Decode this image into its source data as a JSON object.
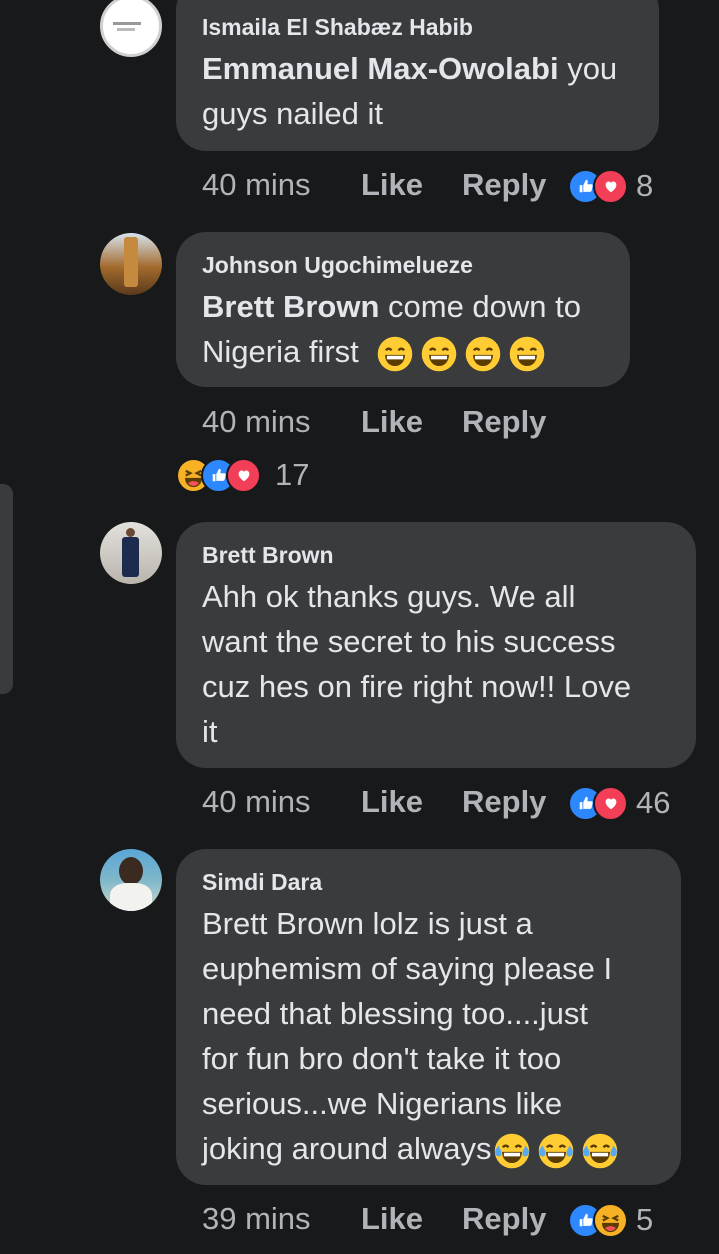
{
  "comments": [
    {
      "author": "Ismaila El Shabæz Habib",
      "mention": "Emmanuel Max-Owolabi",
      "text_lines": [
        " you",
        "guys nailed it"
      ],
      "time": "40 mins",
      "like_label": "Like",
      "reply_label": "Reply",
      "reactions": [
        "like",
        "love"
      ],
      "reaction_count": "8"
    },
    {
      "author": "Johnson Ugochimelueze",
      "mention": "Brett Brown",
      "text_lines": [
        " come down to",
        "Nigeria first"
      ],
      "emojis": [
        "grinning-squint-emoji",
        "grinning-squint-emoji",
        "grinning-squint-emoji",
        "grinning-squint-emoji"
      ],
      "time": "40 mins",
      "like_label": "Like",
      "reply_label": "Reply",
      "reactions": [
        "haha",
        "like",
        "love"
      ],
      "reaction_count": "17"
    },
    {
      "author": "Brett Brown",
      "text_lines": [
        "Ahh ok thanks guys. We all",
        "want the secret to his success",
        "cuz hes on fire right now!! Love",
        "it"
      ],
      "time": "40 mins",
      "like_label": "Like",
      "reply_label": "Reply",
      "reactions": [
        "like",
        "love"
      ],
      "reaction_count": "46"
    },
    {
      "author": "Simdi Dara",
      "text_lines": [
        "Brett Brown lolz is just a",
        "euphemism of saying please I",
        "need that blessing too....just",
        "for fun bro don't take it too",
        "serious...we Nigerians like",
        "joking around always"
      ],
      "emojis": [
        "tears-of-joy-emoji",
        "tears-of-joy-emoji",
        "tears-of-joy-emoji"
      ],
      "time": "39 mins",
      "like_label": "Like",
      "reply_label": "Reply",
      "reactions": [
        "like",
        "haha"
      ],
      "reaction_count": "5"
    }
  ],
  "colors": {
    "background": "#18191a",
    "bubble": "#3a3b3c",
    "text": "#e4e6eb",
    "secondary_text": "#b0b3b8",
    "like_blue": "#2d88ff",
    "love_red": "#f33e58",
    "haha_yellow": "#f7b125"
  }
}
